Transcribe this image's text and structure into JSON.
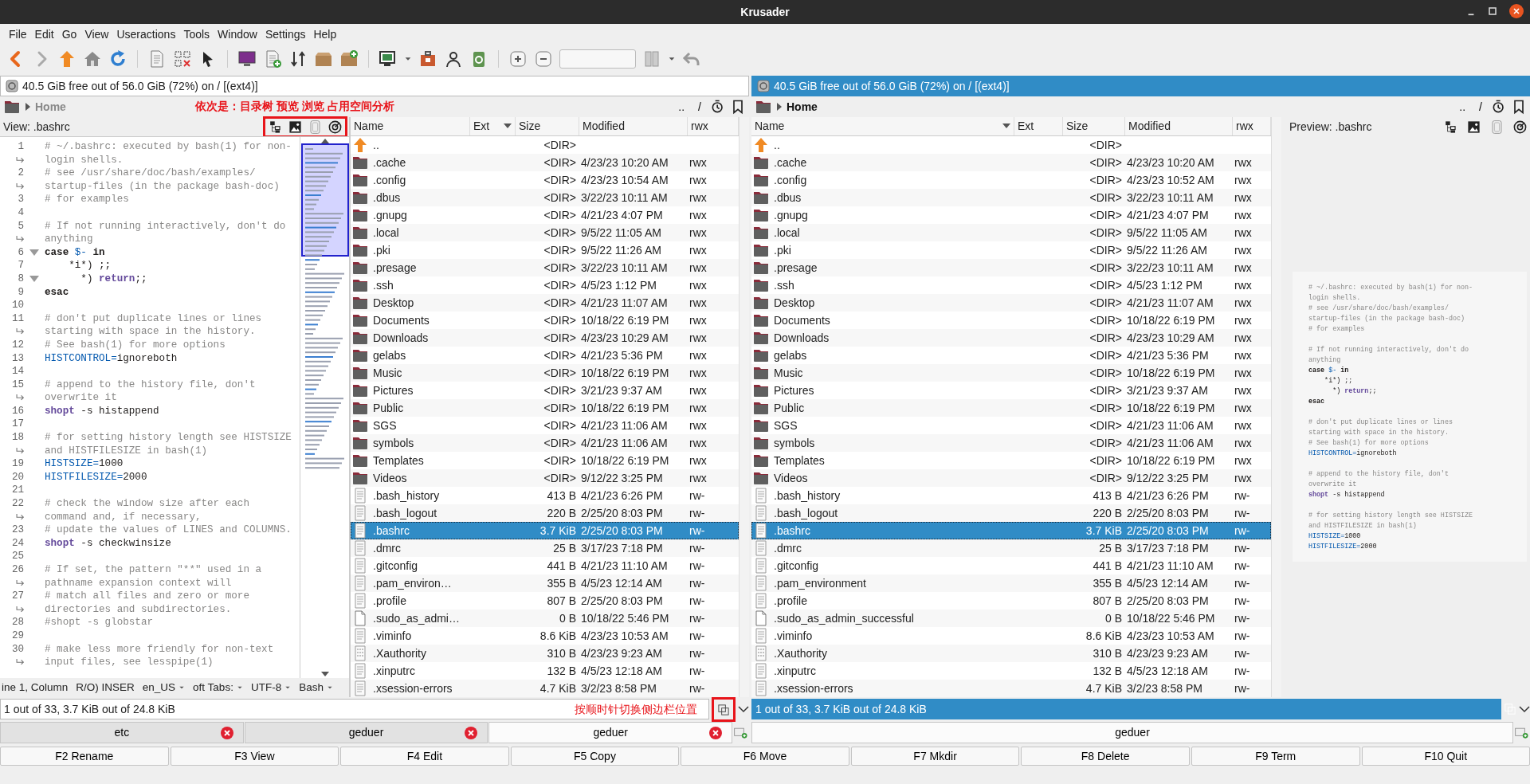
{
  "window": {
    "title": "Krusader"
  },
  "menu": [
    "File",
    "Edit",
    "Go",
    "View",
    "Useractions",
    "Tools",
    "Window",
    "Settings",
    "Help"
  ],
  "left_panel": {
    "active": false,
    "free_space": "40.5 GiB free out of 56.0 GiB (72%) on / [(ext4)]",
    "location": "Home",
    "nav": [
      "..",
      "/"
    ],
    "note": "依次是：目录树 预览 浏览 占用空间分析",
    "sidebar": {
      "kind": "editor",
      "title": "View: .bashrc",
      "lines": [
        {
          "no": "1",
          "fold": false,
          "segs": [
            {
              "kind": "c",
              "text": "# ~/.bashrc: executed by bash(1) for non-"
            }
          ]
        },
        {
          "fold": false,
          "segs": [
            {
              "kind": "c",
              "text": "login shells."
            }
          ]
        },
        {
          "no": "2",
          "fold": false,
          "segs": [
            {
              "kind": "c",
              "text": "# see /usr/share/doc/bash/examples/"
            }
          ]
        },
        {
          "fold": false,
          "segs": [
            {
              "kind": "c",
              "text": "startup-files (in the package bash-doc)"
            }
          ]
        },
        {
          "no": "3",
          "fold": false,
          "segs": [
            {
              "kind": "c",
              "text": "# for examples"
            }
          ]
        },
        {
          "no": "4",
          "fold": false
        },
        {
          "no": "5",
          "fold": false,
          "segs": [
            {
              "kind": "c",
              "text": "# If not running interactively, don't do"
            }
          ]
        },
        {
          "fold": false,
          "segs": [
            {
              "kind": "c",
              "text": "anything"
            }
          ]
        },
        {
          "no": "6",
          "fold": true,
          "segs": [
            {
              "kind": "k",
              "text": "case"
            },
            {
              "kind": "v",
              "text": " $- "
            },
            {
              "kind": "k",
              "text": "in"
            }
          ]
        },
        {
          "no": "7",
          "fold": false,
          "segs": [
            {
              "kind": "p",
              "text": "    *i*) ;;"
            }
          ]
        },
        {
          "no": "8",
          "fold": true,
          "segs": [
            {
              "kind": "p",
              "text": "      *) "
            },
            {
              "kind": "b",
              "text": "return"
            },
            {
              "kind": "p",
              "text": ";;"
            }
          ]
        },
        {
          "no": "9",
          "fold": false,
          "segs": [
            {
              "kind": "k",
              "text": "esac"
            }
          ]
        },
        {
          "no": "10",
          "fold": false
        },
        {
          "no": "11",
          "fold": false,
          "segs": [
            {
              "kind": "c",
              "text": "# don't put duplicate lines or lines"
            }
          ]
        },
        {
          "fold": false,
          "segs": [
            {
              "kind": "c",
              "text": "starting with space in the history."
            }
          ]
        },
        {
          "no": "12",
          "fold": false,
          "segs": [
            {
              "kind": "c",
              "text": "# See bash(1) for more options"
            }
          ]
        },
        {
          "no": "13",
          "fold": false,
          "segs": [
            {
              "kind": "v",
              "text": "HISTCONTROL="
            },
            {
              "kind": "p",
              "text": "ignoreboth"
            }
          ]
        },
        {
          "no": "14",
          "fold": false
        },
        {
          "no": "15",
          "fold": false,
          "segs": [
            {
              "kind": "c",
              "text": "# append to the history file, don't"
            }
          ]
        },
        {
          "fold": false,
          "segs": [
            {
              "kind": "c",
              "text": "overwrite it"
            }
          ]
        },
        {
          "no": "16",
          "fold": false,
          "segs": [
            {
              "kind": "b",
              "text": "shopt"
            },
            {
              "kind": "p",
              "text": " -s histappend"
            }
          ]
        },
        {
          "no": "17",
          "fold": false
        },
        {
          "no": "18",
          "fold": false,
          "segs": [
            {
              "kind": "c",
              "text": "# for setting history length see HISTSIZE"
            }
          ]
        },
        {
          "fold": false,
          "segs": [
            {
              "kind": "c",
              "text": "and HISTFILESIZE in bash(1)"
            }
          ]
        },
        {
          "no": "19",
          "fold": false,
          "segs": [
            {
              "kind": "v",
              "text": "HISTSIZE="
            },
            {
              "kind": "p",
              "text": "1000"
            }
          ]
        },
        {
          "no": "20",
          "fold": false,
          "segs": [
            {
              "kind": "v",
              "text": "HISTFILESIZE="
            },
            {
              "kind": "p",
              "text": "2000"
            }
          ]
        },
        {
          "no": "21",
          "fold": false
        },
        {
          "no": "22",
          "fold": false,
          "segs": [
            {
              "kind": "c",
              "text": "# check the window size after each"
            }
          ]
        },
        {
          "fold": false,
          "segs": [
            {
              "kind": "c",
              "text": "command and, if necessary,"
            }
          ]
        },
        {
          "no": "23",
          "fold": false,
          "segs": [
            {
              "kind": "c",
              "text": "# update the values of LINES and COLUMNS."
            }
          ]
        },
        {
          "no": "24",
          "fold": false,
          "segs": [
            {
              "kind": "b",
              "text": "shopt"
            },
            {
              "kind": "p",
              "text": " -s checkwinsize"
            }
          ]
        },
        {
          "no": "25",
          "fold": false
        },
        {
          "no": "26",
          "fold": false,
          "segs": [
            {
              "kind": "c",
              "text": "# If set, the pattern \"**\" used in a"
            }
          ]
        },
        {
          "fold": false,
          "segs": [
            {
              "kind": "c",
              "text": "pathname expansion context will"
            }
          ]
        },
        {
          "no": "27",
          "fold": false,
          "segs": [
            {
              "kind": "c",
              "text": "# match all files and zero or more"
            }
          ]
        },
        {
          "fold": false,
          "segs": [
            {
              "kind": "c",
              "text": "directories and subdirectories."
            }
          ]
        },
        {
          "no": "28",
          "fold": false,
          "segs": [
            {
              "kind": "c",
              "text": "#shopt -s globstar"
            }
          ]
        },
        {
          "no": "29",
          "fold": false
        },
        {
          "no": "30",
          "fold": false,
          "segs": [
            {
              "kind": "c",
              "text": "# make less more friendly for non-text"
            }
          ]
        },
        {
          "fold": false,
          "segs": [
            {
              "kind": "c",
              "text": "input files, see lesspipe(1)"
            }
          ]
        }
      ],
      "status": [
        {
          "text": "ine 1, Column",
          "dropdown": false
        },
        {
          "text": "R/O) INSER",
          "dropdown": false
        },
        {
          "text": "en_US",
          "dropdown": true
        },
        {
          "text": "oft Tabs:",
          "dropdown": true
        },
        {
          "text": "UTF-8",
          "dropdown": true
        },
        {
          "text": "Bash",
          "dropdown": true
        }
      ]
    },
    "columns": [
      {
        "label": "Name",
        "sorted": false
      },
      {
        "label": "Ext",
        "sorted": true
      },
      {
        "label": "Size",
        "sorted": false
      },
      {
        "label": "Modified",
        "sorted": false
      },
      {
        "label": "rwx",
        "sorted": false
      }
    ],
    "rows": [
      {
        "name": "..",
        "size": "<DIR>",
        "kind": "up",
        "selected": false
      },
      {
        "name": ".cache",
        "size": "<DIR>",
        "modified": "4/23/23 10:20 AM",
        "rwx": "rwx",
        "kind": "folder",
        "selected": false
      },
      {
        "name": ".config",
        "size": "<DIR>",
        "modified": "4/23/23 10:54 AM",
        "rwx": "rwx",
        "kind": "folder",
        "selected": false
      },
      {
        "name": ".dbus",
        "size": "<DIR>",
        "modified": "3/22/23 10:11 AM",
        "rwx": "rwx",
        "kind": "folder",
        "selected": false
      },
      {
        "name": ".gnupg",
        "size": "<DIR>",
        "modified": "4/21/23 4:07 PM",
        "rwx": "rwx",
        "kind": "folder",
        "selected": false
      },
      {
        "name": ".local",
        "size": "<DIR>",
        "modified": "9/5/22 11:05 AM",
        "rwx": "rwx",
        "kind": "folder",
        "selected": false
      },
      {
        "name": ".pki",
        "size": "<DIR>",
        "modified": "9/5/22 11:26 AM",
        "rwx": "rwx",
        "kind": "folder",
        "selected": false
      },
      {
        "name": ".presage",
        "size": "<DIR>",
        "modified": "3/22/23 10:11 AM",
        "rwx": "rwx",
        "kind": "folder",
        "selected": false
      },
      {
        "name": ".ssh",
        "size": "<DIR>",
        "modified": "4/5/23 1:12 PM",
        "rwx": "rwx",
        "kind": "folder",
        "selected": false
      },
      {
        "name": "Desktop",
        "size": "<DIR>",
        "modified": "4/21/23 11:07 AM",
        "rwx": "rwx",
        "kind": "folder",
        "selected": false
      },
      {
        "name": "Documents",
        "size": "<DIR>",
        "modified": "10/18/22 6:19 PM",
        "rwx": "rwx",
        "kind": "folder",
        "selected": false
      },
      {
        "name": "Downloads",
        "size": "<DIR>",
        "modified": "4/23/23 10:29 AM",
        "rwx": "rwx",
        "kind": "folder",
        "selected": false
      },
      {
        "name": "gelabs",
        "size": "<DIR>",
        "modified": "4/21/23 5:36 PM",
        "rwx": "rwx",
        "kind": "folder",
        "selected": false
      },
      {
        "name": "Music",
        "size": "<DIR>",
        "modified": "10/18/22 6:19 PM",
        "rwx": "rwx",
        "kind": "folder",
        "selected": false
      },
      {
        "name": "Pictures",
        "size": "<DIR>",
        "modified": "3/21/23 9:37 AM",
        "rwx": "rwx",
        "kind": "folder",
        "selected": false
      },
      {
        "name": "Public",
        "size": "<DIR>",
        "modified": "10/18/22 6:19 PM",
        "rwx": "rwx",
        "kind": "folder",
        "selected": false
      },
      {
        "name": "SGS",
        "size": "<DIR>",
        "modified": "4/21/23 11:06 AM",
        "rwx": "rwx",
        "kind": "folder",
        "selected": false
      },
      {
        "name": "symbols",
        "size": "<DIR>",
        "modified": "4/21/23 11:06 AM",
        "rwx": "rwx",
        "kind": "folder",
        "selected": false
      },
      {
        "name": "Templates",
        "size": "<DIR>",
        "modified": "10/18/22 6:19 PM",
        "rwx": "rwx",
        "kind": "folder",
        "selected": false
      },
      {
        "name": "Videos",
        "size": "<DIR>",
        "modified": "9/12/22 3:25 PM",
        "rwx": "rwx",
        "kind": "folder",
        "selected": false
      },
      {
        "name": ".bash_history",
        "size": "413 B",
        "modified": "4/21/23 6:26 PM",
        "rwx": "rw-",
        "kind": "text",
        "selected": false
      },
      {
        "name": ".bash_logout",
        "size": "220 B",
        "modified": "2/25/20 8:03 PM",
        "rwx": "rw-",
        "kind": "text",
        "selected": false
      },
      {
        "name": ".bashrc",
        "size": "3.7 KiB",
        "modified": "2/25/20 8:03 PM",
        "rwx": "rw-",
        "kind": "text",
        "selected": true
      },
      {
        "name": ".dmrc",
        "size": "25 B",
        "modified": "3/17/23 7:18 PM",
        "rwx": "rw-",
        "kind": "text",
        "selected": false
      },
      {
        "name": ".gitconfig",
        "size": "441 B",
        "modified": "4/21/23 11:10 AM",
        "rwx": "rw-",
        "kind": "text",
        "selected": false
      },
      {
        "name": ".pam_environ…",
        "size": "355 B",
        "modified": "4/5/23 12:14 AM",
        "rwx": "rw-",
        "kind": "text",
        "selected": false
      },
      {
        "name": ".profile",
        "size": "807 B",
        "modified": "2/25/20 8:03 PM",
        "rwx": "rw-",
        "kind": "text",
        "selected": false
      },
      {
        "name": ".sudo_as_admi…",
        "size": "0 B",
        "modified": "10/18/22 5:46 PM",
        "rwx": "rw-",
        "kind": "blank",
        "selected": false
      },
      {
        "name": ".viminfo",
        "size": "8.6 KiB",
        "modified": "4/23/23 10:53 AM",
        "rwx": "rw-",
        "kind": "text",
        "selected": false
      },
      {
        "name": ".Xauthority",
        "size": "310 B",
        "modified": "4/23/23 9:23 AM",
        "rwx": "rw-",
        "kind": "binary",
        "selected": false
      },
      {
        "name": ".xinputrc",
        "size": "132 B",
        "modified": "4/5/23 12:18 AM",
        "rwx": "rw-",
        "kind": "text",
        "selected": false
      },
      {
        "name": ".xsession-errors",
        "size": "4.7 KiB",
        "modified": "3/2/23 8:58 PM",
        "rwx": "rw-",
        "kind": "text",
        "selected": false
      }
    ],
    "status": "1 out of 33, 3.7 KiB out of 24.8 KiB",
    "status_note": "按顺时针切换侧边栏位置",
    "tabs": [
      {
        "label": "etc",
        "selected": false
      },
      {
        "label": "geduer",
        "selected": false
      },
      {
        "label": "geduer",
        "selected": true
      }
    ]
  },
  "right_panel": {
    "active": true,
    "free_space": "40.5 GiB free out of 56.0 GiB (72%) on / [(ext4)]",
    "location": "Home",
    "nav": [
      "..",
      "/"
    ],
    "sidebar": {
      "kind": "preview",
      "title": "Preview: .bashrc",
      "lines": [
        {
          "segs": [
            {
              "kind": "c",
              "text": "# ~/.bashrc: executed by bash(1) for non-"
            }
          ]
        },
        {
          "segs": [
            {
              "kind": "c",
              "text": "login shells."
            }
          ]
        },
        {
          "segs": [
            {
              "kind": "c",
              "text": "# see /usr/share/doc/bash/examples/"
            }
          ]
        },
        {
          "segs": [
            {
              "kind": "c",
              "text": "startup-files (in the package bash-doc)"
            }
          ]
        },
        {
          "segs": [
            {
              "kind": "c",
              "text": "# for examples"
            }
          ]
        },
        {
          "blank": true
        },
        {
          "segs": [
            {
              "kind": "c",
              "text": "# If not running interactively, don't do"
            }
          ]
        },
        {
          "segs": [
            {
              "kind": "c",
              "text": "anything"
            }
          ]
        },
        {
          "segs": [
            {
              "kind": "k",
              "text": "case"
            },
            {
              "kind": "v",
              "text": " $- "
            },
            {
              "kind": "k",
              "text": "in"
            }
          ]
        },
        {
          "segs": [
            {
              "kind": "p",
              "text": "    *i*) ;;"
            }
          ]
        },
        {
          "segs": [
            {
              "kind": "p",
              "text": "      *) "
            },
            {
              "kind": "b",
              "text": "return"
            },
            {
              "kind": "p",
              "text": ";;"
            }
          ]
        },
        {
          "segs": [
            {
              "kind": "k",
              "text": "esac"
            }
          ]
        },
        {
          "blank": true
        },
        {
          "segs": [
            {
              "kind": "c",
              "text": "# don't put duplicate lines or lines"
            }
          ]
        },
        {
          "segs": [
            {
              "kind": "c",
              "text": "starting with space in the history."
            }
          ]
        },
        {
          "segs": [
            {
              "kind": "c",
              "text": "# See bash(1) for more options"
            }
          ]
        },
        {
          "segs": [
            {
              "kind": "v",
              "text": "HISTCONTROL="
            },
            {
              "kind": "p",
              "text": "ignoreboth"
            }
          ]
        },
        {
          "blank": true
        },
        {
          "segs": [
            {
              "kind": "c",
              "text": "# append to the history file, don't"
            }
          ]
        },
        {
          "segs": [
            {
              "kind": "c",
              "text": "overwrite it"
            }
          ]
        },
        {
          "segs": [
            {
              "kind": "b",
              "text": "shopt"
            },
            {
              "kind": "p",
              "text": " -s histappend"
            }
          ]
        },
        {
          "blank": true
        },
        {
          "segs": [
            {
              "kind": "c",
              "text": "# for setting history length see HISTSIZE"
            }
          ]
        },
        {
          "segs": [
            {
              "kind": "c",
              "text": "and HISTFILESIZE in bash(1)"
            }
          ]
        },
        {
          "segs": [
            {
              "kind": "v",
              "text": "HISTSIZE="
            },
            {
              "kind": "p",
              "text": "1000"
            }
          ]
        },
        {
          "segs": [
            {
              "kind": "v",
              "text": "HISTFILESIZE="
            },
            {
              "kind": "p",
              "text": "2000"
            }
          ]
        }
      ]
    },
    "columns": [
      {
        "label": "Name",
        "sorted": true
      },
      {
        "label": "Ext",
        "sorted": false
      },
      {
        "label": "Size",
        "sorted": false
      },
      {
        "label": "Modified",
        "sorted": false
      },
      {
        "label": "rwx",
        "sorted": false
      }
    ],
    "rows": [
      {
        "name": "..",
        "size": "<DIR>",
        "kind": "up",
        "selected": false
      },
      {
        "name": ".cache",
        "size": "<DIR>",
        "modified": "4/23/23 10:20 AM",
        "rwx": "rwx",
        "kind": "folder",
        "selected": false
      },
      {
        "name": ".config",
        "size": "<DIR>",
        "modified": "4/23/23 10:52 AM",
        "rwx": "rwx",
        "kind": "folder",
        "selected": false
      },
      {
        "name": ".dbus",
        "size": "<DIR>",
        "modified": "3/22/23 10:11 AM",
        "rwx": "rwx",
        "kind": "folder",
        "selected": false
      },
      {
        "name": ".gnupg",
        "size": "<DIR>",
        "modified": "4/21/23 4:07 PM",
        "rwx": "rwx",
        "kind": "folder",
        "selected": false
      },
      {
        "name": ".local",
        "size": "<DIR>",
        "modified": "9/5/22 11:05 AM",
        "rwx": "rwx",
        "kind": "folder",
        "selected": false
      },
      {
        "name": ".pki",
        "size": "<DIR>",
        "modified": "9/5/22 11:26 AM",
        "rwx": "rwx",
        "kind": "folder",
        "selected": false
      },
      {
        "name": ".presage",
        "size": "<DIR>",
        "modified": "3/22/23 10:11 AM",
        "rwx": "rwx",
        "kind": "folder",
        "selected": false
      },
      {
        "name": ".ssh",
        "size": "<DIR>",
        "modified": "4/5/23 1:12 PM",
        "rwx": "rwx",
        "kind": "folder",
        "selected": false
      },
      {
        "name": "Desktop",
        "size": "<DIR>",
        "modified": "4/21/23 11:07 AM",
        "rwx": "rwx",
        "kind": "folder",
        "selected": false
      },
      {
        "name": "Documents",
        "size": "<DIR>",
        "modified": "10/18/22 6:19 PM",
        "rwx": "rwx",
        "kind": "folder",
        "selected": false
      },
      {
        "name": "Downloads",
        "size": "<DIR>",
        "modified": "4/23/23 10:29 AM",
        "rwx": "rwx",
        "kind": "folder",
        "selected": false
      },
      {
        "name": "gelabs",
        "size": "<DIR>",
        "modified": "4/21/23 5:36 PM",
        "rwx": "rwx",
        "kind": "folder",
        "selected": false
      },
      {
        "name": "Music",
        "size": "<DIR>",
        "modified": "10/18/22 6:19 PM",
        "rwx": "rwx",
        "kind": "folder",
        "selected": false
      },
      {
        "name": "Pictures",
        "size": "<DIR>",
        "modified": "3/21/23 9:37 AM",
        "rwx": "rwx",
        "kind": "folder",
        "selected": false
      },
      {
        "name": "Public",
        "size": "<DIR>",
        "modified": "10/18/22 6:19 PM",
        "rwx": "rwx",
        "kind": "folder",
        "selected": false
      },
      {
        "name": "SGS",
        "size": "<DIR>",
        "modified": "4/21/23 11:06 AM",
        "rwx": "rwx",
        "kind": "folder",
        "selected": false
      },
      {
        "name": "symbols",
        "size": "<DIR>",
        "modified": "4/21/23 11:06 AM",
        "rwx": "rwx",
        "kind": "folder",
        "selected": false
      },
      {
        "name": "Templates",
        "size": "<DIR>",
        "modified": "10/18/22 6:19 PM",
        "rwx": "rwx",
        "kind": "folder",
        "selected": false
      },
      {
        "name": "Videos",
        "size": "<DIR>",
        "modified": "9/12/22 3:25 PM",
        "rwx": "rwx",
        "kind": "folder",
        "selected": false
      },
      {
        "name": ".bash_history",
        "size": "413 B",
        "modified": "4/21/23 6:26 PM",
        "rwx": "rw-",
        "kind": "text",
        "selected": false
      },
      {
        "name": ".bash_logout",
        "size": "220 B",
        "modified": "2/25/20 8:03 PM",
        "rwx": "rw-",
        "kind": "text",
        "selected": false
      },
      {
        "name": ".bashrc",
        "size": "3.7 KiB",
        "modified": "2/25/20 8:03 PM",
        "rwx": "rw-",
        "kind": "text",
        "selected": true
      },
      {
        "name": ".dmrc",
        "size": "25 B",
        "modified": "3/17/23 7:18 PM",
        "rwx": "rw-",
        "kind": "text",
        "selected": false
      },
      {
        "name": ".gitconfig",
        "size": "441 B",
        "modified": "4/21/23 11:10 AM",
        "rwx": "rw-",
        "kind": "text",
        "selected": false
      },
      {
        "name": ".pam_environment",
        "size": "355 B",
        "modified": "4/5/23 12:14 AM",
        "rwx": "rw-",
        "kind": "text",
        "selected": false
      },
      {
        "name": ".profile",
        "size": "807 B",
        "modified": "2/25/20 8:03 PM",
        "rwx": "rw-",
        "kind": "text",
        "selected": false
      },
      {
        "name": ".sudo_as_admin_successful",
        "size": "0 B",
        "modified": "10/18/22 5:46 PM",
        "rwx": "rw-",
        "kind": "blank",
        "selected": false
      },
      {
        "name": ".viminfo",
        "size": "8.6 KiB",
        "modified": "4/23/23 10:53 AM",
        "rwx": "rw-",
        "kind": "text",
        "selected": false
      },
      {
        "name": ".Xauthority",
        "size": "310 B",
        "modified": "4/23/23 9:23 AM",
        "rwx": "rw-",
        "kind": "binary",
        "selected": false
      },
      {
        "name": ".xinputrc",
        "size": "132 B",
        "modified": "4/5/23 12:18 AM",
        "rwx": "rw-",
        "kind": "text",
        "selected": false
      },
      {
        "name": ".xsession-errors",
        "size": "4.7 KiB",
        "modified": "3/2/23 8:58 PM",
        "rwx": "rw-",
        "kind": "text",
        "selected": false
      }
    ],
    "status": "1 out of 33, 3.7 KiB out of 24.8 KiB",
    "tabs": [
      {
        "label": "geduer",
        "selected": true
      }
    ]
  },
  "function_keys": [
    "F2 Rename",
    "F3 View",
    "F4 Edit",
    "F5 Copy",
    "F6 Move",
    "F7 Mkdir",
    "F8 Delete",
    "F9 Term",
    "F10 Quit"
  ]
}
